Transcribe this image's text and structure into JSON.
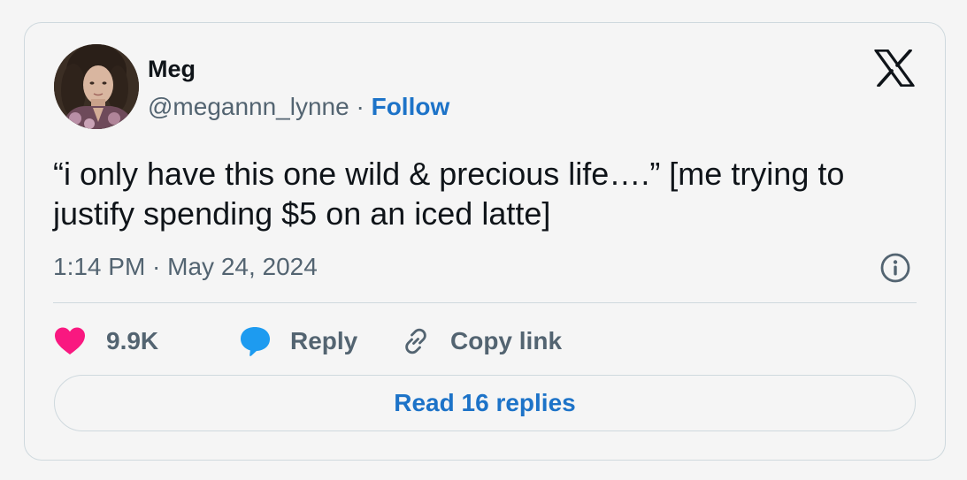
{
  "author": {
    "name": "Meg",
    "handle": "@megannn_lynne",
    "separator": " · ",
    "follow_label": "Follow"
  },
  "brand": {
    "logo_icon": "x-logo-icon"
  },
  "tweet": {
    "text": "“i only have this one wild & precious life….” [me trying to justify spending $5 on an iced latte]",
    "timestamp": "1:14 PM · May 24, 2024"
  },
  "actions": {
    "like_count": "9.9K",
    "reply_label": "Reply",
    "copy_link_label": "Copy link"
  },
  "footer": {
    "read_replies_label": "Read 16 replies"
  },
  "colors": {
    "like_heart": "#f91880",
    "reply_bubble": "#1d9bf0",
    "link_blue": "#1d73c8",
    "secondary_text": "#536471",
    "border": "#cfd9de"
  }
}
